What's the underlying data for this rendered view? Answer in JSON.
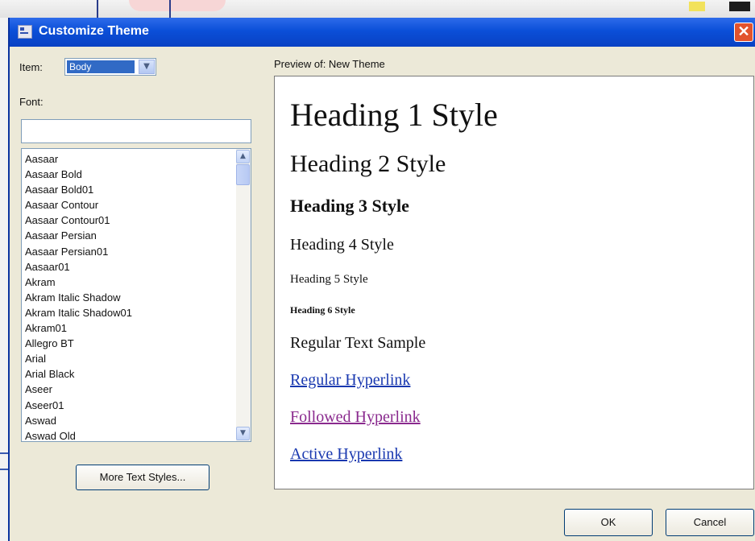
{
  "dialog": {
    "title": "Customize Theme",
    "close_glyph": "✕"
  },
  "item": {
    "label": "Item:",
    "value": "Body",
    "dropdown_glyph": "▼"
  },
  "font": {
    "label": "Font:",
    "input_value": "",
    "list": [
      "Aasaar",
      "Aasaar Bold",
      "Aasaar Bold01",
      "Aasaar Contour",
      "Aasaar Contour01",
      "Aasaar Persian",
      "Aasaar Persian01",
      "Aasaar01",
      "Akram",
      "Akram Italic Shadow",
      "Akram Italic Shadow01",
      "Akram01",
      "Allegro BT",
      "Arial",
      "Arial Black",
      "Aseer",
      "Aseer01",
      "Aswad",
      "Aswad Old"
    ],
    "scroll_up_glyph": "▲",
    "scroll_down_glyph": "▼"
  },
  "buttons": {
    "more_text_styles": "More Text Styles...",
    "ok": "OK",
    "cancel": "Cancel"
  },
  "preview": {
    "label": "Preview of: New Theme",
    "heading1": "Heading 1 Style",
    "heading2": "Heading 2 Style",
    "heading3": "Heading 3 Style",
    "heading4": "Heading 4 Style",
    "heading5": "Heading 5 Style",
    "heading6": "Heading 6 Style",
    "regular_text": "Regular Text Sample",
    "regular_hyperlink": "Regular Hyperlink",
    "followed_hyperlink": "Followed Hyperlink",
    "active_hyperlink": "Active Hyperlink"
  },
  "colors": {
    "titlebar": "#0b4fd8",
    "dialog_bg": "#ece9d8",
    "link": "#1a39b0",
    "followed_link": "#8a2a8e",
    "selection": "#316ac5"
  }
}
